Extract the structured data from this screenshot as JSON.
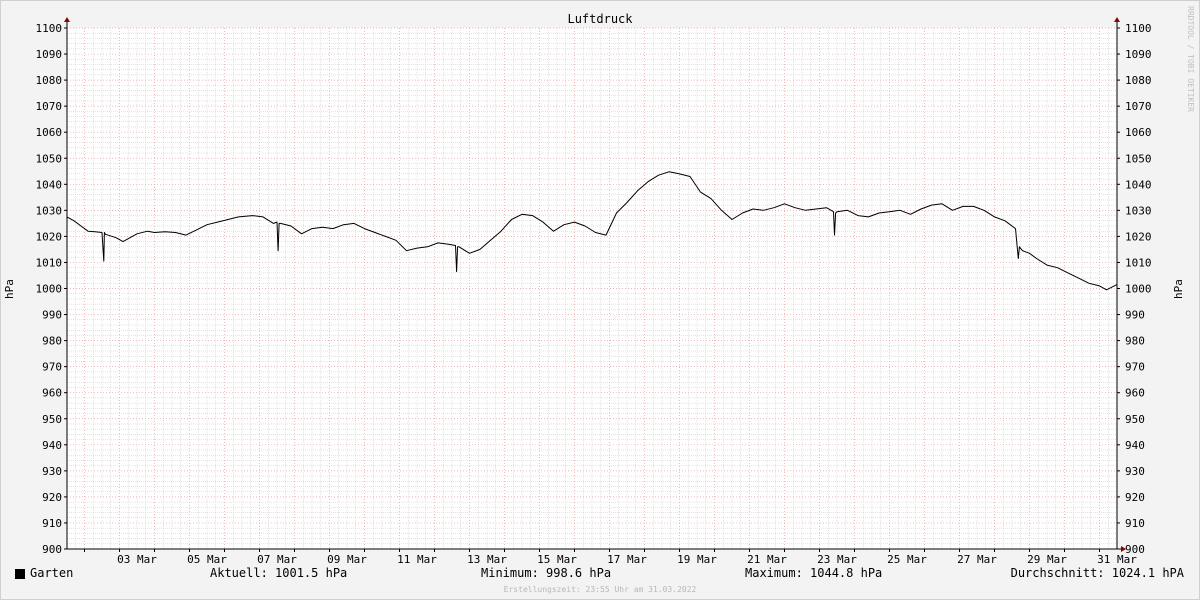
{
  "chart_data": {
    "type": "line",
    "title": "Luftdruck",
    "ylabel": "hPa",
    "xlabel": "",
    "ylim": [
      900,
      1100
    ],
    "y_ticks": [
      900,
      910,
      920,
      930,
      940,
      950,
      960,
      970,
      980,
      990,
      1000,
      1010,
      1020,
      1030,
      1040,
      1050,
      1060,
      1070,
      1080,
      1090,
      1100
    ],
    "x_range_days": [
      1.5,
      31.5
    ],
    "x_tick_labels": [
      {
        "day": 3,
        "label": "03 Mar"
      },
      {
        "day": 5,
        "label": "05 Mar"
      },
      {
        "day": 7,
        "label": "07 Mar"
      },
      {
        "day": 9,
        "label": "09 Mar"
      },
      {
        "day": 11,
        "label": "11 Mar"
      },
      {
        "day": 13,
        "label": "13 Mar"
      },
      {
        "day": 15,
        "label": "15 Mar"
      },
      {
        "day": 17,
        "label": "17 Mar"
      },
      {
        "day": 19,
        "label": "19 Mar"
      },
      {
        "day": 21,
        "label": "21 Mar"
      },
      {
        "day": 23,
        "label": "23 Mar"
      },
      {
        "day": 25,
        "label": "25 Mar"
      },
      {
        "day": 27,
        "label": "27 Mar"
      },
      {
        "day": 29,
        "label": "29 Mar"
      },
      {
        "day": 31,
        "label": "31 Mar"
      }
    ],
    "grid": true,
    "line_color": "#000000",
    "major_grid_color": "#e8a0a0",
    "minor_grid_color": "#c8c8c8",
    "series": [
      {
        "name": "Garten",
        "x": [
          1.5,
          1.7,
          1.9,
          2.1,
          2.3,
          2.5,
          2.55,
          2.57,
          2.6,
          2.9,
          3.1,
          3.3,
          3.5,
          3.8,
          4.0,
          4.3,
          4.6,
          4.9,
          5.2,
          5.5,
          5.8,
          6.1,
          6.4,
          6.8,
          7.1,
          7.4,
          7.5,
          7.53,
          7.56,
          7.6,
          7.9,
          8.2,
          8.5,
          8.8,
          9.1,
          9.4,
          9.7,
          10.0,
          10.3,
          10.6,
          10.9,
          11.2,
          11.5,
          11.8,
          12.1,
          12.4,
          12.6,
          12.63,
          12.66,
          12.7,
          13.0,
          13.3,
          13.6,
          13.9,
          14.2,
          14.5,
          14.8,
          15.1,
          15.4,
          15.7,
          16.0,
          16.3,
          16.6,
          16.9,
          17.2,
          17.5,
          17.8,
          18.1,
          18.4,
          18.7,
          19.0,
          19.3,
          19.6,
          19.9,
          20.2,
          20.5,
          20.8,
          21.1,
          21.4,
          21.7,
          22.0,
          22.3,
          22.6,
          22.9,
          23.2,
          23.4,
          23.43,
          23.46,
          23.5,
          23.8,
          24.1,
          24.4,
          24.7,
          25.0,
          25.3,
          25.6,
          25.9,
          26.2,
          26.5,
          26.8,
          27.1,
          27.4,
          27.7,
          28.0,
          28.3,
          28.6,
          28.65,
          28.68,
          28.71,
          28.8,
          29.0,
          29.2,
          29.5,
          29.8,
          30.1,
          30.4,
          30.7,
          31.0,
          31.2,
          31.5
        ],
        "values": [
          1027.5,
          1026,
          1024,
          1022,
          1021.8,
          1021.5,
          1010.5,
          1021.5,
          1020.8,
          1019.5,
          1018,
          1019.5,
          1021,
          1022,
          1021.5,
          1021.8,
          1021.5,
          1020.5,
          1022.5,
          1024.5,
          1025.5,
          1026.5,
          1027.5,
          1028,
          1027.5,
          1025,
          1025.5,
          1014.5,
          1025,
          1025,
          1024,
          1021,
          1023,
          1023.5,
          1023,
          1024.5,
          1025,
          1023,
          1021.5,
          1020,
          1018.5,
          1014.5,
          1015.5,
          1016,
          1017.5,
          1017,
          1016.5,
          1006.5,
          1016,
          1016,
          1013.5,
          1015,
          1018.5,
          1022,
          1026.5,
          1028.5,
          1028,
          1025.5,
          1022,
          1024.5,
          1025.5,
          1024,
          1021.5,
          1020.5,
          1029,
          1033,
          1037.5,
          1041,
          1043.5,
          1044.8,
          1044,
          1043,
          1037,
          1034.5,
          1030,
          1026.5,
          1029,
          1030.5,
          1030,
          1031,
          1032.5,
          1031,
          1030,
          1030.5,
          1031,
          1029.5,
          1020.5,
          1029,
          1029.5,
          1030,
          1028,
          1027.5,
          1029,
          1029.5,
          1030,
          1028.5,
          1030.5,
          1032,
          1032.5,
          1030,
          1031.5,
          1031.5,
          1030,
          1027.5,
          1026,
          1023,
          1016,
          1011.5,
          1016,
          1014.5,
          1013.5,
          1011.5,
          1009,
          1008,
          1006,
          1004,
          1002,
          1001,
          999.5,
          1001.5
        ]
      }
    ]
  },
  "legend": {
    "series_label": "Garten",
    "aktuell": "Aktuell: 1001.5 hPa",
    "minimum": "Minimum: 998.6 hPa",
    "maximum": "Maximum: 1044.8 hPa",
    "durchschnitt": "Durchschnitt: 1024.1 hPA"
  },
  "footer": "Erstellungszeit: 23:55 Uhr am 31.03.2022",
  "watermark": "RRDTOOL / TOBI OETIKER"
}
